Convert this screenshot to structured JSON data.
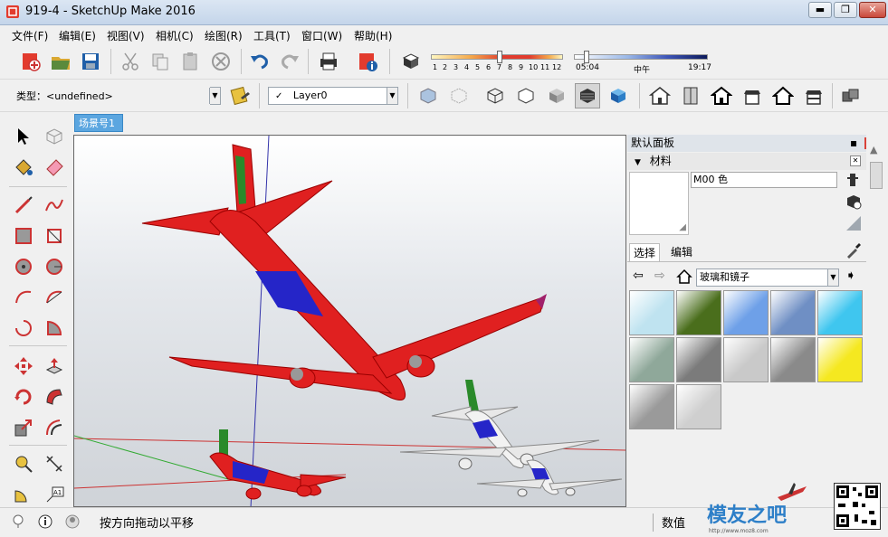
{
  "window": {
    "title": "919-4 - SketchUp Make 2016",
    "controls": [
      "minimize",
      "maximize",
      "close"
    ]
  },
  "menu": {
    "items": [
      "文件(F)",
      "编辑(E)",
      "视图(V)",
      "相机(C)",
      "绘图(R)",
      "工具(T)",
      "窗口(W)",
      "帮助(H)"
    ]
  },
  "toolbar": {
    "icons": [
      "new-model-icon",
      "open-icon",
      "save-icon",
      "cut-icon",
      "copy-icon",
      "paste-icon",
      "erase-icon",
      "undo-icon",
      "redo-icon",
      "print-icon",
      "model-info-icon",
      "shadows-icon"
    ],
    "shadow_months": [
      "1",
      "2",
      "3",
      "4",
      "5",
      "6",
      "7",
      "8",
      "9",
      "10",
      "11",
      "12"
    ],
    "time_start": "05:04",
    "time_mid": "中午",
    "time_end": "19:17",
    "month_slider_level": 0.52,
    "time_slider_level": 0.08
  },
  "toolbar2": {
    "type_label": "类型：<undefined>",
    "layer_check": "✓",
    "layer_value": "Layer0",
    "style_icons": [
      "xray-icon",
      "back-edges-icon",
      "wireframe-icon",
      "hidden-line-icon",
      "shaded-icon",
      "shaded-textures-icon",
      "monochrome-icon"
    ],
    "view_icons": [
      "iso-view-icon",
      "top-view-icon",
      "front-view-icon",
      "right-view-icon",
      "back-view-icon",
      "left-view-icon",
      "components-icon"
    ]
  },
  "scene": {
    "tab_label": "场景号1"
  },
  "panel": {
    "tray_title": "默认面板",
    "section_title": "材料",
    "material_name": "M00 色",
    "tab_select": "选择",
    "tab_edit": "编辑",
    "library": "玻璃和镜子",
    "swatch_colors": [
      "#bfe3f0",
      "#4a6e1c",
      "#6ea0e8",
      "#6f8fc4",
      "#3fc6ef",
      "#8fa89a",
      "#7b7b7b",
      "#c9c9c9",
      "#8a8a8a",
      "#f5e820",
      "#9a9a9a",
      "#cfcfcf"
    ]
  },
  "status": {
    "message": "按方向拖动以平移",
    "measurement_label": "数值",
    "watermark": "模友之吧",
    "watermark_url": "http://www.moz8.com"
  }
}
